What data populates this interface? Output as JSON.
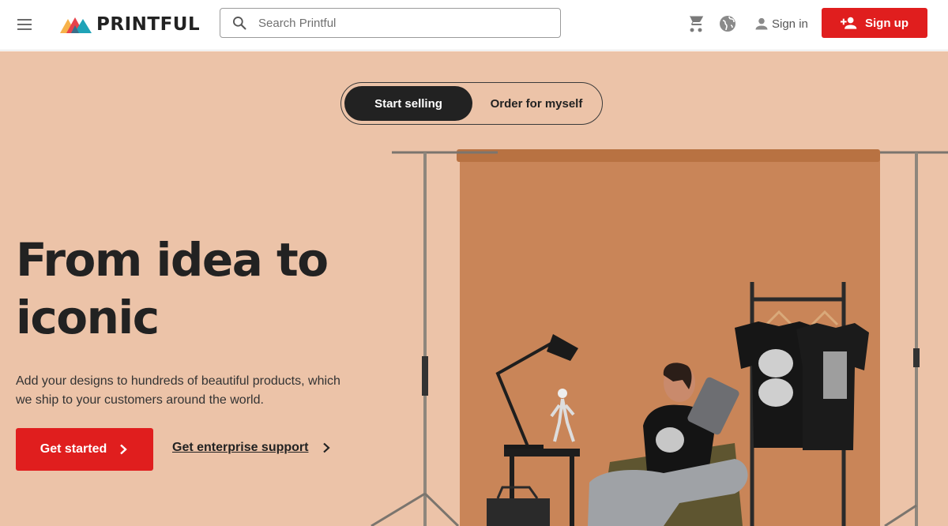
{
  "header": {
    "menu_icon": "hamburger-menu-icon",
    "logo_text": "PRINTFUL",
    "search": {
      "placeholder": "Search Printful",
      "value": ""
    },
    "cart_icon": "cart-icon",
    "language_icon": "globe-icon",
    "sign_in_label": "Sign in",
    "sign_up_label": "Sign up"
  },
  "hero": {
    "toggle": [
      {
        "label": "Start selling",
        "active": true
      },
      {
        "label": "Order for myself",
        "active": false
      }
    ],
    "headline_line1": "From idea to",
    "headline_line2": "iconic",
    "subtext": "Add your designs to hundreds of beautiful products, which we ship to your customers around the world.",
    "primary_cta": "Get started",
    "secondary_cta": "Get enterprise support"
  },
  "colors": {
    "accent": "#e01e1e",
    "hero_background": "#ecc3a8",
    "backdrop": "#c98558",
    "text_dark": "#222222"
  }
}
